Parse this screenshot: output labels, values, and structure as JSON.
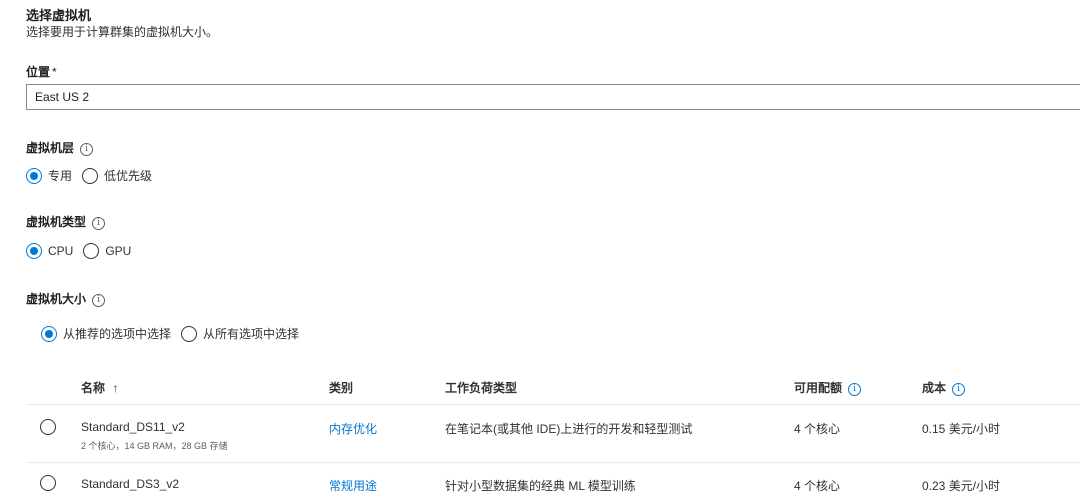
{
  "header": {
    "title": "选择虚拟机",
    "subtitle": "选择要用于计算群集的虚拟机大小。"
  },
  "location": {
    "label": "位置",
    "required_mark": "*",
    "value": "East US 2"
  },
  "vm_tier": {
    "label": "虚拟机层",
    "options": [
      {
        "label": "专用",
        "checked": true
      },
      {
        "label": "低优先级",
        "checked": false
      }
    ]
  },
  "vm_type": {
    "label": "虚拟机类型",
    "options": [
      {
        "label": "CPU",
        "checked": true
      },
      {
        "label": "GPU",
        "checked": false
      }
    ]
  },
  "vm_size": {
    "label": "虚拟机大小",
    "options": [
      {
        "label": "从推荐的选项中选择",
        "checked": true
      },
      {
        "label": "从所有选项中选择",
        "checked": false
      }
    ]
  },
  "table": {
    "headers": {
      "name": "名称",
      "sort_arrow": "↑",
      "category": "类别",
      "workload": "工作负荷类型",
      "quota": "可用配额",
      "cost": "成本"
    },
    "rows": [
      {
        "name": "Standard_DS11_v2",
        "specs": "2 个核心，14 GB RAM，28 GB 存储",
        "category": "内存优化",
        "workload": "在笔记本(或其他 IDE)上进行的开发和轻型测试",
        "quota": "4 个核心",
        "cost": "0.15 美元/小时"
      },
      {
        "name": "Standard_DS3_v2",
        "specs": "",
        "category": "常规用途",
        "workload": "针对小型数据集的经典 ML 模型训练",
        "quota": "4 个核心",
        "cost": "0.23 美元/小时"
      }
    ]
  },
  "colors": {
    "accent": "#0078d4",
    "text": "#201f1e",
    "border": "#8a8886"
  }
}
